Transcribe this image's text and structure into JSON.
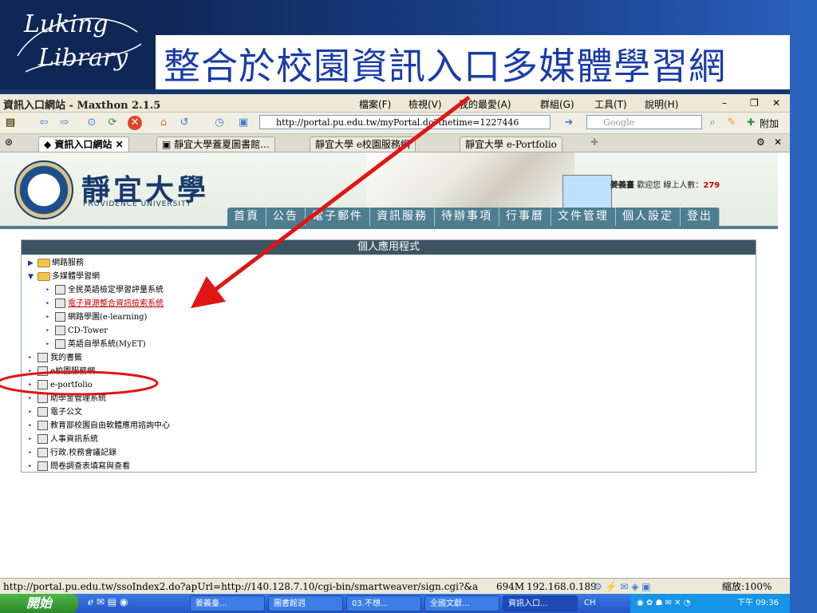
{
  "slide": {
    "logo_line1": "Luking",
    "logo_line2": "Library",
    "title": "整合於校園資訊入口多媒體學習網"
  },
  "browser": {
    "window_title": "資訊入口網站 - Maxthon 2.1.5",
    "menu": [
      "檔案(F)",
      "檢視(V)",
      "我的最愛(A)",
      "群組(G)",
      "工具(T)",
      "說明(H)"
    ],
    "address": "http://portal.pu.edu.tw/myPortal.do?thetime=1227446",
    "search_placeholder": "Google",
    "addon_label": "附加",
    "tabs": [
      {
        "label": "資訊入口網站",
        "active": true
      },
      {
        "label": "靜宜大學蓋夏圖書館..."
      },
      {
        "label": "靜宜大學 e校園服務網"
      },
      {
        "label": "靜宜大學 e-Portfolio"
      }
    ]
  },
  "portal": {
    "uni_name": "靜宜大學",
    "uni_en": "PROVIDENCE UNIVERSITY",
    "welcome_name": "姜義臺",
    "welcome_text": "歡迎您",
    "online_label": "線上人數：",
    "online_count": "279",
    "nav": [
      "首頁",
      "公告",
      "電子郵件",
      "資訊服務",
      "待辦事項",
      "行事曆",
      "文件管理",
      "個人設定",
      "登出"
    ],
    "panel_title": "個人應用程式",
    "tree": {
      "network": "網路服務",
      "multimedia": "多媒體學習網",
      "gept": "全民英語檢定學習評量系統",
      "eresource": "電子資源整合資訊檢索系統",
      "elearning": "網路學園(e-learning)",
      "cdtower": "CD-Tower",
      "myet": "英語自學系統(MyET)",
      "bookmarks": "我的書籤",
      "eservice": "e校園服務網",
      "eportfolio": "e-portfolio",
      "scholarship": "助學金管理系統",
      "edoc": "電子公文",
      "moe": "教育部校園自由軟體應用諮詢中心",
      "hr": "人事資訊系統",
      "meeting": "行政.校務會議記錄",
      "survey": "問卷調查表填寫與查看"
    }
  },
  "status": {
    "url": "http://portal.pu.edu.tw/ssoIndex2.do?apUrl=http://140.128.7.10/cgi-bin/smartweaver/sign.cgi?&a",
    "memory": "694M",
    "ip": "192.168.0.189",
    "zoom": "縮放:100%"
  },
  "taskbar": {
    "start": "開始",
    "tasks": [
      "姜義臺...",
      "圖書館週",
      "03.不想...",
      "全國文獻...",
      "資訊入口..."
    ],
    "ime": "CH",
    "clock": "下午 09:36"
  }
}
